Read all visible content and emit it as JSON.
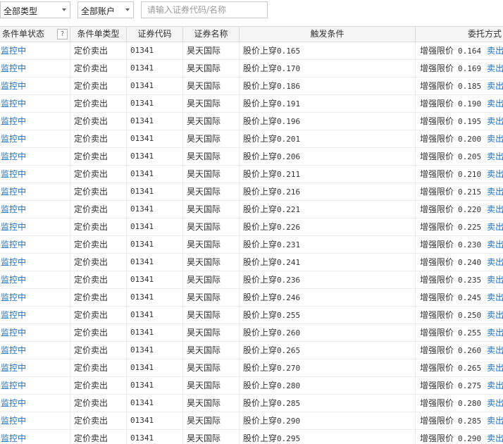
{
  "toolbar": {
    "type_filter": "全部类型",
    "account_filter": "全部账户",
    "search_placeholder": "请输入证券代码/名称"
  },
  "columns": [
    "条件单状态",
    "条件单类型",
    "证券代码",
    "证券名称",
    "触发条件",
    "委托方式"
  ],
  "help_mark": "?",
  "common": {
    "status": "监控中",
    "type": "定价卖出",
    "code": "01341",
    "name": "昊天国际",
    "trigger_prefix": "股价上穿",
    "order_prefix": "增强限价",
    "side": "卖出"
  },
  "rows": [
    {
      "trigger": "0.165",
      "price": "0.164"
    },
    {
      "trigger": "0.170",
      "price": "0.169"
    },
    {
      "trigger": "0.186",
      "price": "0.185"
    },
    {
      "trigger": "0.191",
      "price": "0.190"
    },
    {
      "trigger": "0.196",
      "price": "0.195"
    },
    {
      "trigger": "0.201",
      "price": "0.200"
    },
    {
      "trigger": "0.206",
      "price": "0.205"
    },
    {
      "trigger": "0.211",
      "price": "0.210"
    },
    {
      "trigger": "0.216",
      "price": "0.215"
    },
    {
      "trigger": "0.221",
      "price": "0.220"
    },
    {
      "trigger": "0.226",
      "price": "0.225"
    },
    {
      "trigger": "0.231",
      "price": "0.230"
    },
    {
      "trigger": "0.241",
      "price": "0.240"
    },
    {
      "trigger": "0.236",
      "price": "0.235"
    },
    {
      "trigger": "0.246",
      "price": "0.245"
    },
    {
      "trigger": "0.255",
      "price": "0.250"
    },
    {
      "trigger": "0.260",
      "price": "0.255"
    },
    {
      "trigger": "0.265",
      "price": "0.260"
    },
    {
      "trigger": "0.270",
      "price": "0.265"
    },
    {
      "trigger": "0.280",
      "price": "0.275"
    },
    {
      "trigger": "0.285",
      "price": "0.280"
    },
    {
      "trigger": "0.290",
      "price": "0.285"
    },
    {
      "trigger": "0.295",
      "price": "0.290"
    }
  ]
}
